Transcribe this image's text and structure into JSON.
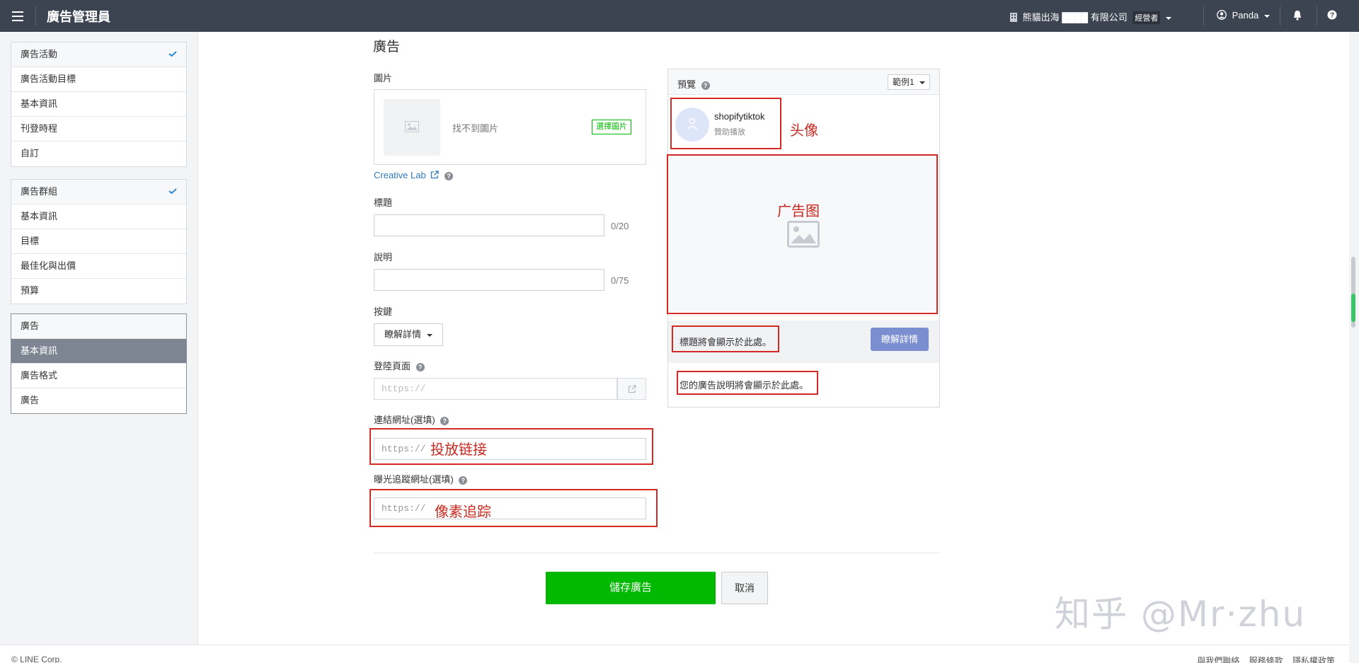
{
  "topbar": {
    "app_title": "廣告管理員",
    "company": "熊貓出海 ████ 有限公司",
    "role": "經營者",
    "user": "Panda"
  },
  "sidebar": {
    "campaign": {
      "items": [
        "廣告活動",
        "廣告活動目標",
        "基本資訊",
        "刊登時程",
        "自訂"
      ]
    },
    "adgroup": {
      "items": [
        "廣告群組",
        "基本資訊",
        "目標",
        "最佳化與出價",
        "預算"
      ]
    },
    "ad": {
      "items": [
        "廣告",
        "基本資訊",
        "廣告格式",
        "廣告"
      ]
    }
  },
  "form": {
    "section_title": "廣告",
    "image_label": "圖片",
    "no_image": "找不到圖片",
    "select_image": "選擇圖片",
    "creative_lab": "Creative Lab",
    "title_label": "標題",
    "title_counter": "0/20",
    "desc_label": "說明",
    "desc_counter": "0/75",
    "button_label": "按鍵",
    "button_value": "瞭解詳情",
    "landing_label": "登陸頁面",
    "landing_placeholder": "https://",
    "link_label": "連結網址(選填)",
    "link_placeholder": "https://",
    "tracking_label": "曝光追蹤網址(選填)",
    "tracking_placeholder": "https://"
  },
  "preview": {
    "title": "預覽",
    "example": "範例1",
    "account_name": "shopifytiktok",
    "sponsored": "贊助播放",
    "headline_placeholder": "標題將會顯示於此處。",
    "cta": "瞭解詳情",
    "desc_placeholder": "您的廣告說明將會顯示於此處。"
  },
  "annotations": {
    "avatar": "头像",
    "ad_image": "广告图",
    "link": "投放链接",
    "pixel": "像素追踪"
  },
  "actions": {
    "save": "儲存廣告",
    "cancel": "取消"
  },
  "watermark": "知乎 @Mr·zhu",
  "footer": {
    "copyright": "© LINE Corp.",
    "links": [
      "與我們聯絡",
      "服務條款",
      "隱私權政策"
    ]
  },
  "colors": {
    "topbar": "#3c4451",
    "accent_green": "#00b900",
    "annotation_red": "#d42a26",
    "cta_blue": "#7b8fd0",
    "link_blue": "#337ab7"
  }
}
